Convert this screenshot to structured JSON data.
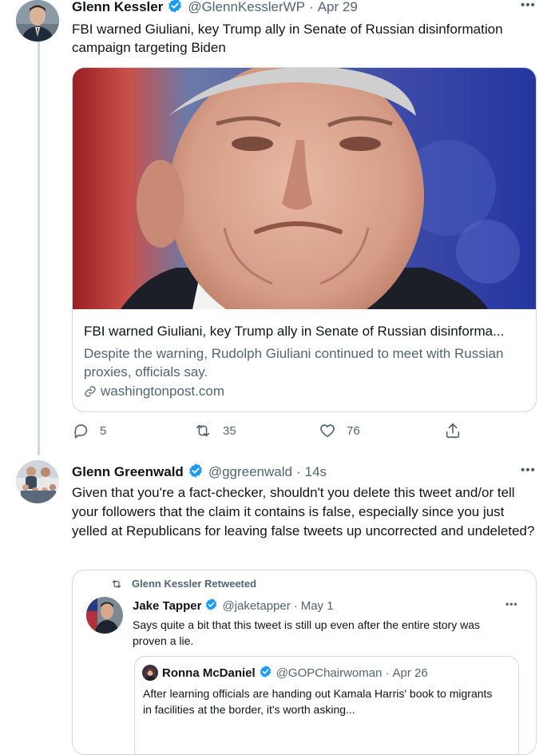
{
  "tweet1": {
    "name": "Glenn Kessler",
    "handle": "@GlennKesslerWP",
    "separator": "·",
    "time": "Apr 29",
    "text": "FBI warned Giuliani, key Trump ally in Senate of Russian disinformation campaign targeting Biden",
    "card": {
      "title": "FBI warned Giuliani, key Trump ally in Senate of Russian disinforma...",
      "description": "Despite the warning, Rudolph Giuliani continued to meet with Russian proxies, officials say.",
      "domain": "washingtonpost.com"
    },
    "actions": {
      "replies": "5",
      "retweets": "35",
      "likes": "76"
    }
  },
  "tweet2": {
    "name": "Glenn Greenwald",
    "handle": "@ggreenwald",
    "separator": "·",
    "time": "14s",
    "text": "Given that you're a fact-checker, shouldn't you delete this tweet and/or tell your followers that the claim it contains is false, especially since you just yelled at Republicans for leaving false tweets up uncorrected and undeleted?"
  },
  "quoted": {
    "retweeted_label": "Glenn Kessler Retweeted",
    "name": "Jake Tapper",
    "handle": "@jaketapper",
    "separator": "·",
    "time": "May 1",
    "text": "Says quite a bit that this tweet is still up even after the entire story was proven a lie.",
    "nested": {
      "name": "Ronna McDaniel",
      "handle": "@GOPChairwoman",
      "separator": "·",
      "time": "Apr 26",
      "text": "After learning officials are handing out Kamala Harris' book to migrants in facilities at the border, it's worth asking..."
    }
  },
  "more_label": "•••",
  "colors": {
    "verified": "#1d9bf0",
    "secondary_text": "#536471",
    "border": "#cfd9de"
  }
}
